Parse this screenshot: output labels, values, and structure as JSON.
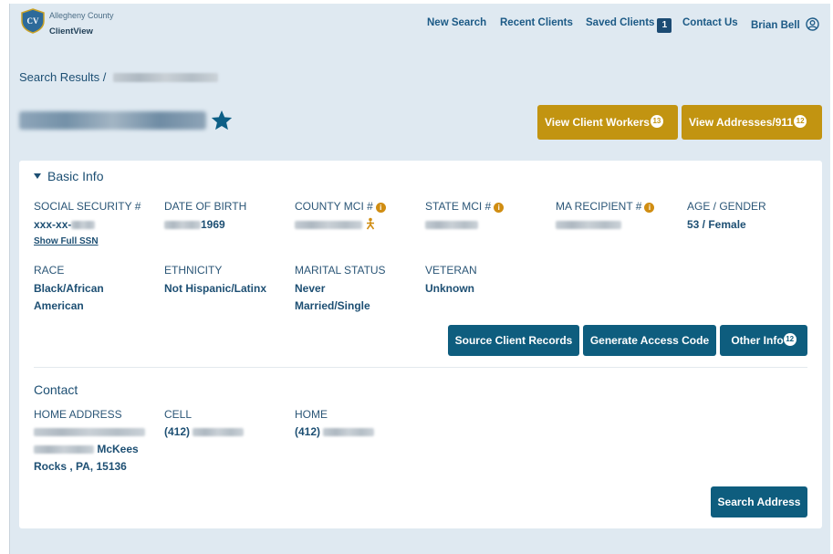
{
  "app": {
    "county": "Allegheny County",
    "name": "ClientView",
    "logo_text": "CV"
  },
  "nav": {
    "new_search": "New Search",
    "recent_clients": "Recent Clients",
    "saved_clients": "Saved Clients",
    "saved_count": "1",
    "contact_us": "Contact Us",
    "user_name": "Brian Bell"
  },
  "breadcrumb": {
    "root": "Search Results",
    "separator": "/"
  },
  "header_buttons": {
    "client_workers": "View Client Workers",
    "client_workers_count": "13",
    "addresses": "View Addresses/911",
    "addresses_count": "12"
  },
  "basic_info": {
    "title": "Basic Info",
    "ssn_label": "SOCIAL SECURITY #",
    "ssn_value": "xxx-xx-",
    "show_ssn": "Show Full SSN",
    "dob_label": "DATE OF BIRTH",
    "dob_year": "1969",
    "county_mci_label": "COUNTY MCI #",
    "state_mci_label": "STATE MCI #",
    "ma_label": "MA RECIPIENT #",
    "age_gender_label": "AGE / GENDER",
    "age_gender_value": "53 / Female",
    "race_label": "RACE",
    "race_value": "Black/African American",
    "ethnicity_label": "ETHNICITY",
    "ethnicity_value": "Not Hispanic/Latinx",
    "marital_label": "MARITAL STATUS",
    "marital_value": "Never Married/Single",
    "veteran_label": "VETERAN",
    "veteran_value": "Unknown",
    "btn_source": "Source Client Records",
    "btn_access": "Generate Access Code",
    "btn_other": "Other Info",
    "other_count": "12"
  },
  "contact": {
    "title": "Contact",
    "home_address_label": "HOME ADDRESS",
    "address_city": "McKees Rocks , PA, 15136",
    "cell_label": "CELL",
    "cell_prefix": "(412)",
    "home_label": "HOME",
    "home_prefix": "(412)",
    "btn_search_address": "Search Address"
  },
  "colors": {
    "gold": "#c29411",
    "teal": "#0e5d7e",
    "background": "#dfe9f1"
  },
  "icons": [
    "shield-logo-icon",
    "user-circle-icon",
    "star-icon",
    "info-icon",
    "person-link-icon",
    "caret-down-icon"
  ]
}
